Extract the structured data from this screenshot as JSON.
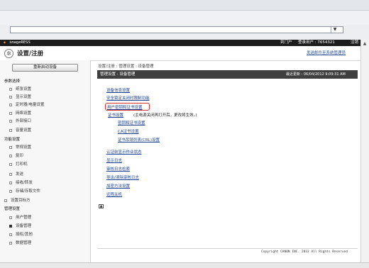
{
  "app": {
    "brand": "imageRESS",
    "portal_link": "到门户",
    "login_user": "登录用户 : 7654321",
    "logout_link": "注销",
    "page_title": "设置/注册",
    "mail_admin_link": "发送邮件至系统管理员"
  },
  "sidebar": {
    "restart_button": "重新启动设备",
    "sections": [
      {
        "label": "参数选择",
        "items": [
          "纸张设置",
          "显示设置",
          "定时器/电量设置",
          "网络设置",
          "外部接口",
          "音量设置"
        ]
      },
      {
        "label": "功能设置",
        "items": [
          "常规设置",
          "复印",
          "打印机"
        ]
      },
      {
        "label": "",
        "items": [
          "发送",
          "接收/转发",
          "存储/存取文件"
        ]
      },
      {
        "label": "",
        "items": [
          "设置目标方"
        ]
      },
      {
        "label": "管理设置",
        "items": [
          "用户管理",
          "设备管理",
          "授权/其他",
          "数据管理"
        ]
      }
    ]
  },
  "main": {
    "breadcrumb": "设置/注册 : 管理设置 : 设备管理",
    "header_title": "管理设置 : 设备管理",
    "last_update": "最近更新 : 06/04/2012 9:09:31 AM",
    "links": {
      "device_info": "设备信息设置",
      "security_shutdown": "安全锁定关闭时限制功能",
      "user_key_cert": "用户密钥和证书设置",
      "cert_settings": "证书设置",
      "cert_note": "(主电源关闭再打开后，更改将生效。)",
      "key_cert": "密钥和证书设置",
      "ca_cert": "CA证书设置",
      "crl": "证书吊销列表(CRL)设置",
      "auth_display": "认证前显示作业状态",
      "display_log": "显示日志",
      "audit_log": "审核日志检索",
      "export_audit_log": "导出/清除审核日志",
      "encryption": "加密方法设置",
      "remote_off": "远程关机"
    },
    "copyright": "Copyright CANON INC. 2012 All Rights Reserved"
  }
}
